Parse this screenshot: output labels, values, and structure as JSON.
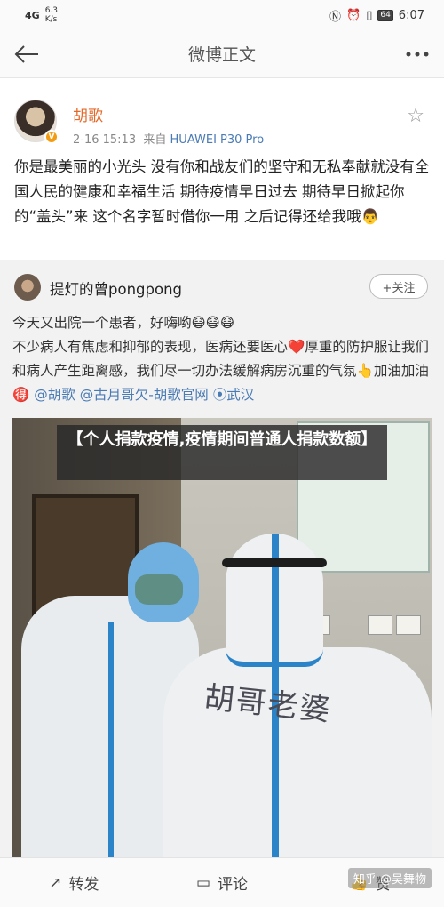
{
  "status_bar": {
    "signal": "4G",
    "speed_value": "6.3",
    "speed_unit": "K/s",
    "battery": "64",
    "time": "6:07"
  },
  "nav": {
    "title": "微博正文",
    "back_icon": "arrow-left-icon",
    "more_icon": "more-dots-icon"
  },
  "post": {
    "author": "胡歌",
    "date": "2-16 15:13",
    "source_prefix": "来自",
    "device": "HUAWEI P30 Pro",
    "body": "你是最美丽的小光头 没有你和战友们的坚守和无私奉献就没有全国人民的健康和幸福生活 期待疫情早日过去 期待早日掀起你的“盖头”来 这个名字暂时借你一用 之后记得还给我哦👨"
  },
  "repost": {
    "author": "提灯的曾pongpong",
    "follow_label": "+关注",
    "line1": "今天又出院一个患者，好嗨哟😷😷😷",
    "line2_start": "不少病人有焦虑和抑郁的表现，医病还要医心",
    "heart": "❤️",
    "line2_end": "厚重的防护服让我们和病人产生距离感，我们尽一切办法缓解病房沉重的气氛",
    "cheer_text": "加油加油",
    "mention1": "@胡歌",
    "mention2": "@古月哥欠-胡歌官网",
    "location": "武汉",
    "photo_writing": "胡哥老婆"
  },
  "banner_text": "【个人捐款疫情,疫情期间普通人捐款数额】",
  "bottom_bar": {
    "repost_label": "转发",
    "comment_label": "评论",
    "like_label": "赞"
  },
  "watermark": "知乎 @吴舞物"
}
